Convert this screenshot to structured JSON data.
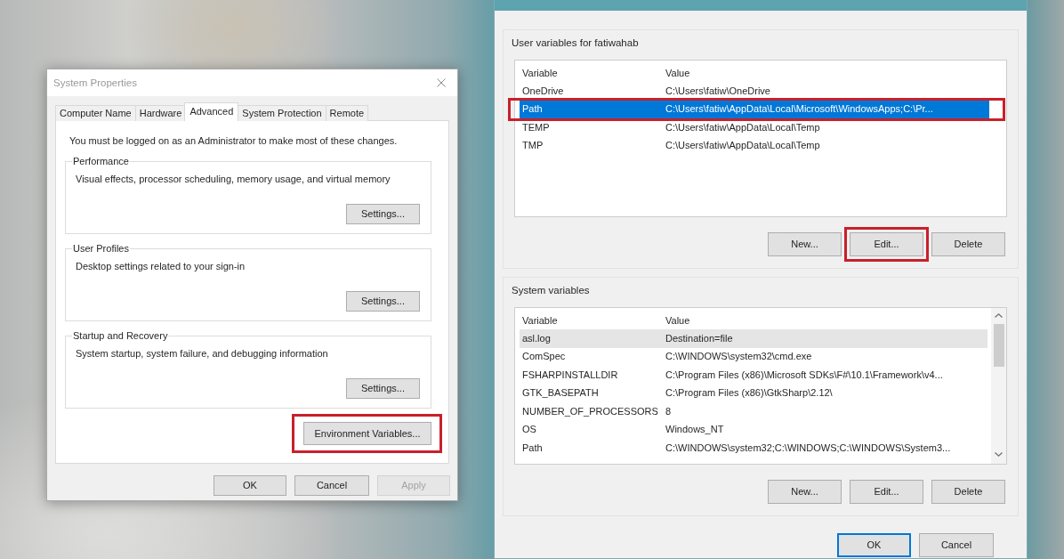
{
  "system_properties": {
    "title": "System Properties",
    "active": false,
    "tabs": [
      {
        "label": "Computer Name",
        "selected": false
      },
      {
        "label": "Hardware",
        "selected": false
      },
      {
        "label": "Advanced",
        "selected": true
      },
      {
        "label": "System Protection",
        "selected": false
      },
      {
        "label": "Remote",
        "selected": false
      }
    ],
    "notice": "You must be logged on as an Administrator to make most of these changes.",
    "groups": [
      {
        "label": "Performance",
        "description": "Visual effects, processor scheduling, memory usage, and virtual memory",
        "button": "Settings..."
      },
      {
        "label": "User Profiles",
        "description": "Desktop settings related to your sign-in",
        "button": "Settings..."
      },
      {
        "label": "Startup and Recovery",
        "description": "System startup, system failure, and debugging information",
        "button": "Settings..."
      }
    ],
    "environment_button": {
      "label": "Environment Variables...",
      "highlighted": true
    },
    "buttons": [
      {
        "label": "OK",
        "disabled": false
      },
      {
        "label": "Cancel",
        "disabled": false
      },
      {
        "label": "Apply",
        "disabled": true
      }
    ]
  },
  "environment_variables": {
    "active": true,
    "sections": [
      {
        "label": "User variables for fatiwahab",
        "focused": true,
        "scrollable": false,
        "columns": [
          "Variable",
          "Value"
        ],
        "rows": [
          {
            "variable": "OneDrive",
            "value": "C:\\Users\\fatiw\\OneDrive",
            "selected": false,
            "highlighted": false
          },
          {
            "variable": "Path",
            "value": "C:\\Users\\fatiw\\AppData\\Local\\Microsoft\\WindowsApps;C:\\Pr...",
            "selected": true,
            "highlighted": true
          },
          {
            "variable": "TEMP",
            "value": "C:\\Users\\fatiw\\AppData\\Local\\Temp",
            "selected": false,
            "highlighted": false
          },
          {
            "variable": "TMP",
            "value": "C:\\Users\\fatiw\\AppData\\Local\\Temp",
            "selected": false,
            "highlighted": false
          }
        ],
        "buttons": [
          {
            "label": "New...",
            "highlighted": false
          },
          {
            "label": "Edit...",
            "highlighted": true
          },
          {
            "label": "Delete",
            "highlighted": false
          }
        ]
      },
      {
        "label": "System variables",
        "focused": false,
        "scrollable": true,
        "columns": [
          "Variable",
          "Value"
        ],
        "rows": [
          {
            "variable": "asl.log",
            "value": "Destination=file",
            "selected": true,
            "highlighted": false
          },
          {
            "variable": "ComSpec",
            "value": "C:\\WINDOWS\\system32\\cmd.exe",
            "selected": false,
            "highlighted": false
          },
          {
            "variable": "FSHARPINSTALLDIR",
            "value": "C:\\Program Files (x86)\\Microsoft SDKs\\F#\\10.1\\Framework\\v4...",
            "selected": false,
            "highlighted": false
          },
          {
            "variable": "GTK_BASEPATH",
            "value": "C:\\Program Files (x86)\\GtkSharp\\2.12\\",
            "selected": false,
            "highlighted": false
          },
          {
            "variable": "NUMBER_OF_PROCESSORS",
            "value": "8",
            "selected": false,
            "highlighted": false
          },
          {
            "variable": "OS",
            "value": "Windows_NT",
            "selected": false,
            "highlighted": false
          },
          {
            "variable": "Path",
            "value": "C:\\WINDOWS\\system32;C:\\WINDOWS;C:\\WINDOWS\\System3...",
            "selected": false,
            "highlighted": false
          }
        ],
        "buttons": [
          {
            "label": "New...",
            "highlighted": false
          },
          {
            "label": "Edit...",
            "highlighted": false
          },
          {
            "label": "Delete",
            "highlighted": false
          }
        ]
      }
    ],
    "buttons": [
      {
        "label": "OK",
        "default": true
      },
      {
        "label": "Cancel",
        "default": false
      }
    ]
  }
}
